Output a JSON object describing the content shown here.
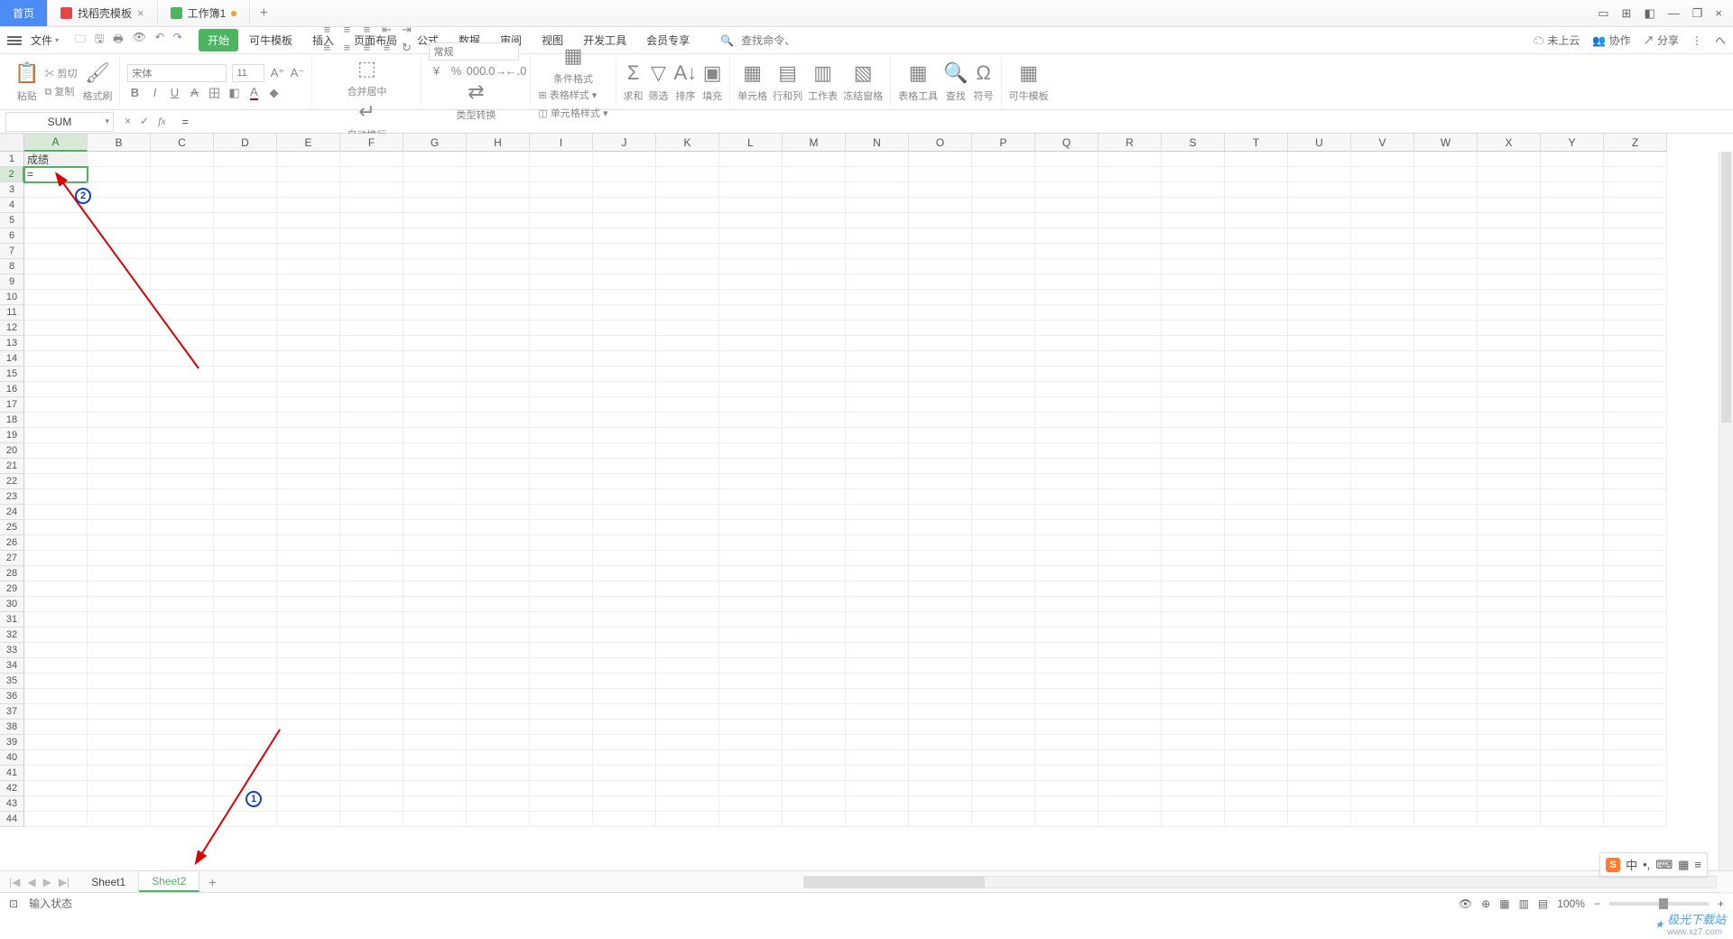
{
  "titlebar": {
    "home": "首页",
    "doc1": "找稻壳模板",
    "doc2": "工作簿1",
    "add": "+",
    "close_x": "×",
    "win_icons": [
      "▭",
      "⊞",
      "◧",
      "—",
      "❐",
      "×"
    ]
  },
  "menubar": {
    "file": "文件",
    "tabs": [
      "开始",
      "可牛模板",
      "插入",
      "页面布局",
      "公式",
      "数据",
      "审阅",
      "视图",
      "开发工具",
      "会员专享"
    ],
    "search_ph": "查找命令、搜索模板",
    "right": {
      "cloud": "未上云",
      "collab": "协作",
      "share": "分享"
    }
  },
  "ribbon": {
    "paste": "粘贴",
    "cut": "剪切",
    "copy": "复制",
    "brush": "格式刷",
    "font": "宋体",
    "size": "11",
    "merge": "合并居中",
    "wrap": "自动换行",
    "numfmt": "常规",
    "type_conv": "类型转换",
    "cond": "条件格式",
    "table_style": "表格样式",
    "cell_style": "单元格样式",
    "sum": "求和",
    "filter": "筛选",
    "sort": "排序",
    "fill": "填充",
    "cell": "单元格",
    "rowcol": "行和列",
    "sheet": "工作表",
    "freeze": "冻结窗格",
    "tools": "表格工具",
    "find": "查找",
    "symbol": "符号",
    "templates": "可牛模板"
  },
  "formula": {
    "name": "SUM",
    "cancel": "×",
    "ok": "✓",
    "fx": "fx",
    "content": "="
  },
  "grid": {
    "cols": [
      "A",
      "B",
      "C",
      "D",
      "E",
      "F",
      "G",
      "H",
      "I",
      "J",
      "K",
      "L",
      "M",
      "N",
      "O",
      "P",
      "Q",
      "R",
      "S",
      "T",
      "U",
      "V",
      "W",
      "X",
      "Y",
      "Z"
    ],
    "rowcount": 44,
    "a1": "成绩",
    "a2": "=",
    "badge1": "1",
    "badge2": "2"
  },
  "sheets": {
    "nav": [
      "|◀",
      "◀",
      "▶",
      "▶|"
    ],
    "tabs": [
      "Sheet1",
      "Sheet2"
    ],
    "active": 1,
    "add": "+"
  },
  "status": {
    "mode": "输入状态",
    "zoom": "100%"
  },
  "ime": [
    "中",
    "•,",
    "⌨",
    "▦",
    "≡"
  ],
  "watermark": {
    "main": "极光下载站",
    "sub": "www.xz7.com"
  }
}
